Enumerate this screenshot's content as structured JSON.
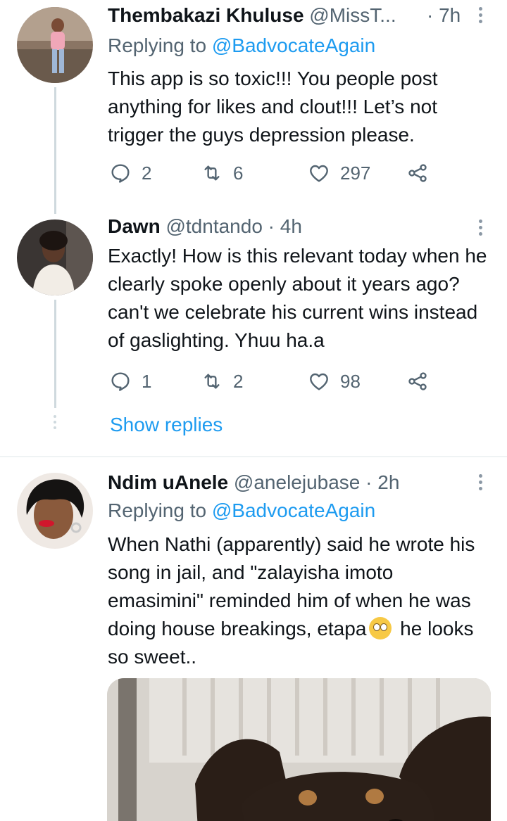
{
  "tweets": [
    {
      "name": "Thembakazi Khuluse",
      "handle": "@MissT...",
      "separator": "·",
      "time": "7h",
      "replying_prefix": "Replying to ",
      "replying_to": "@BadvocateAgain",
      "text": "This app is so toxic!!! You people post anything for likes and clout!!! Let’s not trigger the guys depression please.",
      "replies": "2",
      "retweets": "6",
      "likes": "297"
    },
    {
      "name": "Dawn",
      "handle": "@tdntando",
      "separator": "·",
      "time": "4h",
      "text": "Exactly! How is this relevant today when he clearly spoke openly about it years ago? can't we celebrate his current wins instead of gaslighting. Yhuu ha.a",
      "replies": "1",
      "retweets": "2",
      "likes": "98"
    },
    {
      "name": "Ndim uAnele",
      "handle": "@anelejubase",
      "separator": "·",
      "time": "2h",
      "replying_prefix": "Replying to ",
      "replying_to": "@BadvocateAgain",
      "text_before_emoji": "When Nathi (apparently) said he wrote his song in jail, and \"zalayisha imoto emasimini\" reminded him of when he was doing house breakings, etapa",
      "emoji": "face-with-rolling-eyes",
      "text_after_emoji": " he looks so sweet.."
    }
  ],
  "show_replies_label": "Show replies",
  "colors": {
    "accent": "#1d9bf0",
    "secondary_text": "#536471",
    "primary_text": "#0f1419",
    "thread_line": "#cfd9de"
  },
  "icons": [
    "reply-icon",
    "retweet-icon",
    "like-icon",
    "share-icon",
    "more-options-icon"
  ]
}
